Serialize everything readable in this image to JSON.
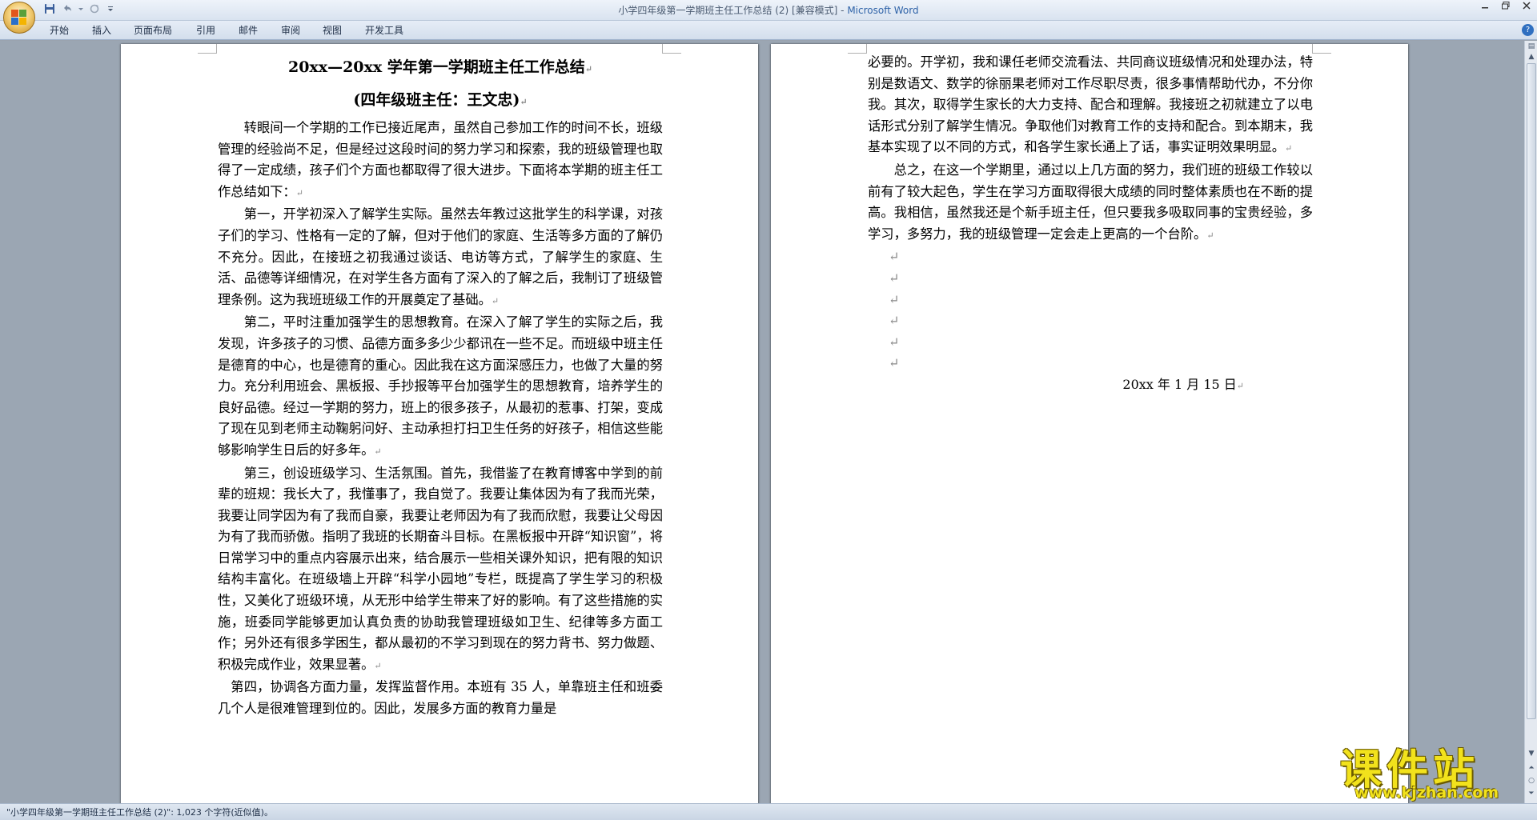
{
  "window": {
    "title_doc": "小学四年级第一学期班主任工作总结 (2) [兼容模式] - ",
    "title_app": "Microsoft Word"
  },
  "ribbon": {
    "tabs": [
      {
        "label": "开始"
      },
      {
        "label": "插入"
      },
      {
        "label": "页面布局"
      },
      {
        "label": "引用"
      },
      {
        "label": "邮件"
      },
      {
        "label": "审阅"
      },
      {
        "label": "视图"
      },
      {
        "label": "开发工具"
      }
    ]
  },
  "document": {
    "title": "20xx—20xx 学年第一学期班主任工作总结",
    "subtitle": "(四年级班主任：王文忠)",
    "left_paragraphs": [
      "转眼间一个学期的工作已接近尾声，虽然自己参加工作的时间不长，班级管理的经验尚不足，但是经过这段时间的努力学习和探索，我的班级管理也取得了一定成绩，孩子们个方面也都取得了很大进步。下面将本学期的班主任工作总结如下：",
      "第一，开学初深入了解学生实际。虽然去年教过这批学生的科学课，对孩子们的学习、性格有一定的了解，但对于他们的家庭、生活等多方面的了解仍不充分。因此，在接班之初我通过谈话、电访等方式，了解学生的家庭、生活、品德等详细情况，在对学生各方面有了深入的了解之后，我制订了班级管理条例。这为我班班级工作的开展奠定了基础。",
      "第二，平时注重加强学生的思想教育。在深入了解了学生的实际之后，我发现，许多孩子的习惯、品德方面多多少少都讯在一些不足。而班级中班主任是德育的中心，也是德育的重心。因此我在这方面深感压力，也做了大量的努力。充分利用班会、黑板报、手抄报等平台加强学生的思想教育，培养学生的良好品德。经过一学期的努力，班上的很多孩子，从最初的惹事、打架，变成了现在见到老师主动鞠躬问好、主动承担打扫卫生任务的好孩子，相信这些能够影响学生日后的好多年。",
      "第三，创设班级学习、生活氛围。首先，我借鉴了在教育博客中学到的前辈的班规：我长大了，我懂事了，我自觉了。我要让集体因为有了我而光荣，我要让同学因为有了我而自豪，我要让老师因为有了我而欣慰，我要让父母因为有了我而骄傲。指明了我班的长期奋斗目标。在黑板报中开辟“知识窗”，将日常学习中的重点内容展示出来，结合展示一些相关课外知识，把有限的知识结构丰富化。在班级墙上开辟“科学小园地”专栏，既提高了学生学习的积极性，又美化了班级环境，从无形中给学生带来了好的影响。有了这些措施的实施，班委同学能够更加认真负责的协助我管理班级如卫生、纪律等多方面工作；另外还有很多学困生，都从最初的不学习到现在的努力背书、努力做题、积极完成作业，效果显著。",
      "第四，协调各方面力量，发挥监督作用。本班有 35 人，单靠班主任和班委几个人是很难管理到位的。因此，发展多方面的教育力量是"
    ],
    "right_paragraphs": [
      "必要的。开学初，我和课任老师交流看法、共同商议班级情况和处理办法，特别是数语文、数学的徐丽果老师对工作尽职尽责，很多事情帮助代办，不分你我。其次，取得学生家长的大力支持、配合和理解。我接班之初就建立了以电话形式分别了解学生情况。争取他们对教育工作的支持和配合。到本期末，我基本实现了以不同的方式，和各学生家长通上了话，事实证明效果明显。",
      "总之，在这一个学期里，通过以上几方面的努力，我们班的班级工作较以前有了较大起色，学生在学习方面取得很大成绩的同时整体素质也在不断的提高。我相信，虽然我还是个新手班主任，但只要我多吸取同事的宝贵经验，多学习，多努力，我的班级管理一定会走上更高的一个台阶。"
    ],
    "date": "20xx 年 1 月 15 日",
    "paragraph_mark": "↵"
  },
  "statusbar": {
    "text": "\"小学四年级第一学期班主任工作总结 (2)\": 1,023 个字符(近似值)。"
  },
  "watermark": {
    "cn": "课件站",
    "url": "www.kjzhan.com"
  },
  "icons": {
    "office_button": "office-logo-icon",
    "save": "save-icon",
    "undo": "undo-icon",
    "redo": "redo-icon"
  }
}
